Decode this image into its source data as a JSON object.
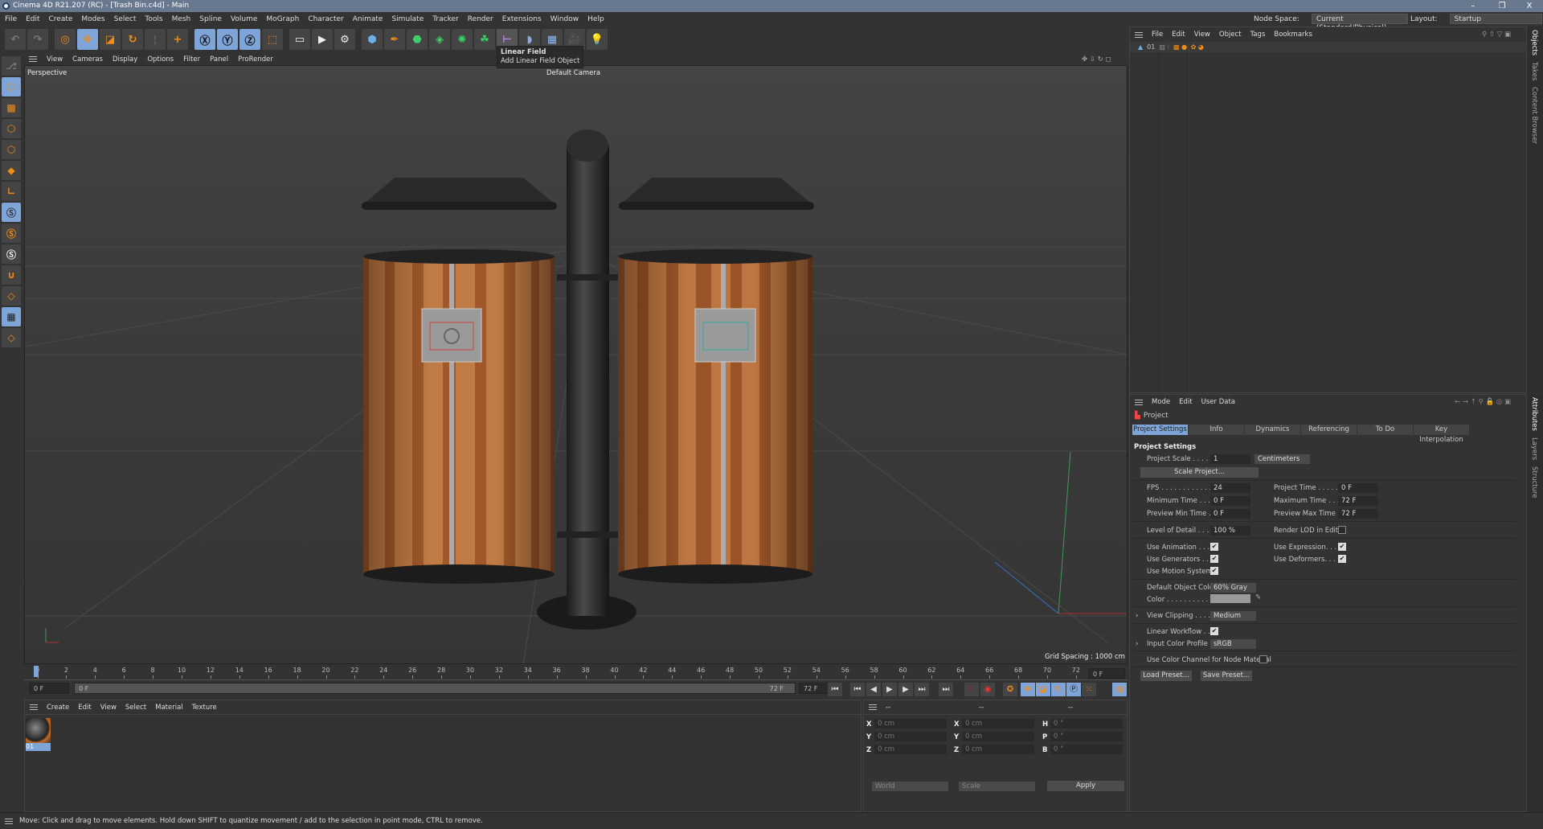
{
  "window": {
    "title": "Cinema 4D R21.207 (RC) - [Trash Bin.c4d] - Main",
    "minimize": "–",
    "restore": "❐",
    "close": "X"
  },
  "menu": [
    "File",
    "Edit",
    "Create",
    "Modes",
    "Select",
    "Tools",
    "Mesh",
    "Spline",
    "Volume",
    "MoGraph",
    "Character",
    "Animate",
    "Simulate",
    "Tracker",
    "Render",
    "Extensions",
    "Window",
    "Help"
  ],
  "node_space": {
    "label": "Node Space:",
    "value": "Current (Standard/Physical)"
  },
  "layout": {
    "label": "Layout:",
    "value": "Startup"
  },
  "toolbar_icons": [
    "undo-icon",
    "redo-icon",
    "live-selection-icon",
    "move-icon",
    "scale-icon",
    "rotate-icon",
    "recent-tool-icon",
    "add-object-icon",
    "x-axis-icon",
    "y-axis-icon",
    "z-axis-icon",
    "coordinate-system-icon",
    "render-view-icon",
    "render-picture-viewer-icon",
    "render-settings-icon",
    "cube-icon",
    "pen-icon",
    "subdivision-icon",
    "cloner-icon",
    "deformer-icon",
    "mograph-icon",
    "linear-field-icon",
    "environment-icon",
    "floor-icon",
    "camera-icon",
    "light-icon"
  ],
  "tooltip": {
    "title": "Linear Field",
    "desc": "Add Linear Field Object"
  },
  "viewport": {
    "menu": [
      "View",
      "Cameras",
      "Display",
      "Options",
      "Filter",
      "Panel",
      "ProRender"
    ],
    "name": "Perspective",
    "camera": "Default Camera",
    "grid": "Grid Spacing : 1000 cm"
  },
  "timeline": {
    "ticks": [
      0,
      2,
      4,
      6,
      8,
      10,
      12,
      14,
      16,
      18,
      20,
      22,
      24,
      26,
      28,
      30,
      32,
      34,
      36,
      38,
      40,
      42,
      44,
      46,
      48,
      50,
      52,
      54,
      56,
      58,
      60,
      62,
      64,
      66,
      68,
      70,
      72
    ],
    "current": "0 F",
    "start": "0 F",
    "slider_start": "0 F",
    "slider_end": "72 F",
    "end": "72 F",
    "end_field": "72 F"
  },
  "material_manager": {
    "menu": [
      "Create",
      "Edit",
      "View",
      "Select",
      "Material",
      "Texture"
    ],
    "material": "01"
  },
  "coordinates": {
    "headers": [
      "--",
      "--",
      "--"
    ],
    "rows": [
      {
        "a": "X",
        "av": "0 cm",
        "b": "X",
        "bv": "0 cm",
        "c": "H",
        "cv": "0 °"
      },
      {
        "a": "Y",
        "av": "0 cm",
        "b": "Y",
        "bv": "0 cm",
        "c": "P",
        "cv": "0 °"
      },
      {
        "a": "Z",
        "av": "0 cm",
        "b": "Z",
        "bv": "0 cm",
        "c": "B",
        "cv": "0 °"
      }
    ],
    "mode": "World",
    "type": "Scale",
    "apply": "Apply"
  },
  "status": "Move: Click and drag to move elements. Hold down SHIFT to quantize movement / add to the selection in point mode, CTRL to remove.",
  "object_manager": {
    "menu": [
      "File",
      "Edit",
      "View",
      "Object",
      "Tags",
      "Bookmarks"
    ],
    "object": "01",
    "tabs": [
      "Objects",
      "Takes",
      "Content Browser"
    ]
  },
  "attributes": {
    "menu": [
      "Mode",
      "Edit",
      "User Data"
    ],
    "object": "Project",
    "tabs": [
      "Project Settings",
      "Info",
      "Dynamics",
      "Referencing",
      "To Do",
      "Key Interpolation"
    ],
    "side_tabs": [
      "Attributes",
      "Layers",
      "Structure"
    ],
    "section": "Project Settings",
    "project_scale_label": "Project Scale . . . . .",
    "project_scale": "1",
    "unit": "Centimeters",
    "scale_project": "Scale Project...",
    "fps_label": "FPS . . . . . . . . . . . .",
    "fps": "24",
    "project_time_label": "Project Time . . . . .",
    "project_time": "0 F",
    "min_time_label": "Minimum Time . . .",
    "min_time": "0 F",
    "max_time_label": "Maximum Time . . .",
    "max_time": "72 F",
    "prev_min_label": "Preview Min Time . .",
    "prev_min": "0 F",
    "prev_max_label": "Preview Max Time .",
    "prev_max": "72 F",
    "lod_label": "Level of Detail . . . .",
    "lod": "100 %",
    "render_lod_label": "Render LOD in Editor",
    "use_animation": "Use Animation . . . .",
    "use_generators": "Use Generators . . . .",
    "use_motion": "Use Motion System",
    "use_expression": "Use Expression. . . .",
    "use_deformers": "Use Deformers. . . .",
    "default_color_label": "Default Object Color",
    "default_color": "60% Gray",
    "color_label": "Color . . . . . . . . . .",
    "view_clipping_label": "View Clipping . . . .",
    "view_clipping": "Medium",
    "linear_workflow": "Linear Workflow . . .",
    "input_profile_label": "Input Color Profile .",
    "input_profile": "sRGB",
    "color_channel": "Use Color Channel for Node Material",
    "load_preset": "Load Preset...",
    "save_preset": "Save Preset..."
  },
  "colors": {
    "accent": "#7ea4d8",
    "icon_orange": "#f28c18",
    "wood": "#a0582a"
  }
}
